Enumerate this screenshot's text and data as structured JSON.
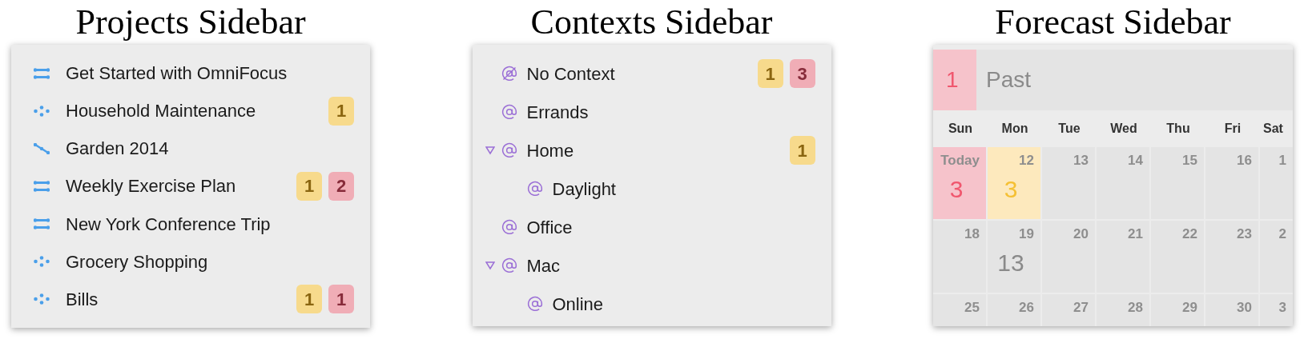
{
  "panels": [
    {
      "kind": "projects",
      "title": "Projects Sidebar",
      "items": [
        {
          "kind": "parallel",
          "label": "Get Started with OmniFocus"
        },
        {
          "kind": "single_actions",
          "label": "Household Maintenance",
          "due_soon": "1"
        },
        {
          "kind": "sequential",
          "label": "Garden 2014"
        },
        {
          "kind": "parallel",
          "label": "Weekly Exercise Plan",
          "due_soon": "1",
          "overdue": "2"
        },
        {
          "kind": "parallel",
          "label": "New York Conference Trip"
        },
        {
          "kind": "single_actions",
          "label": "Grocery Shopping"
        },
        {
          "kind": "single_actions",
          "label": "Bills",
          "due_soon": "1",
          "overdue": "1"
        }
      ]
    },
    {
      "kind": "contexts",
      "title": "Contexts Sidebar",
      "items": [
        {
          "kind": "none",
          "label": "No Context",
          "due_soon": "1",
          "overdue": "3"
        },
        {
          "kind": "context",
          "label": "Errands"
        },
        {
          "kind": "context",
          "label": "Home",
          "due_soon": "1",
          "expanded": true,
          "children": [
            {
              "kind": "context",
              "label": "Daylight"
            }
          ]
        },
        {
          "kind": "context",
          "label": "Office"
        },
        {
          "kind": "context",
          "label": "Mac",
          "expanded": true,
          "children": [
            {
              "kind": "context",
              "label": "Online"
            }
          ]
        }
      ]
    },
    {
      "kind": "forecast",
      "title": "Forecast Sidebar",
      "past": {
        "count": "1",
        "label": "Past"
      },
      "weekdays": [
        "Sun",
        "Mon",
        "Tue",
        "Wed",
        "Thu",
        "Fri",
        "Sat"
      ],
      "weeks": [
        [
          {
            "day": "Today",
            "count": "3",
            "kind": "today"
          },
          {
            "day": "12",
            "count": "3",
            "kind": "due_soon"
          },
          {
            "day": "13"
          },
          {
            "day": "14"
          },
          {
            "day": "15"
          },
          {
            "day": "16"
          },
          {
            "day": "1"
          }
        ],
        [
          {
            "day": "18"
          },
          {
            "day": "19",
            "count": "13"
          },
          {
            "day": "20"
          },
          {
            "day": "21"
          },
          {
            "day": "22"
          },
          {
            "day": "23"
          },
          {
            "day": "2"
          }
        ],
        [
          {
            "day": "25"
          },
          {
            "day": "26"
          },
          {
            "day": "27"
          },
          {
            "day": "28"
          },
          {
            "day": "29"
          },
          {
            "day": "30"
          },
          {
            "day": "3"
          }
        ]
      ]
    }
  ]
}
